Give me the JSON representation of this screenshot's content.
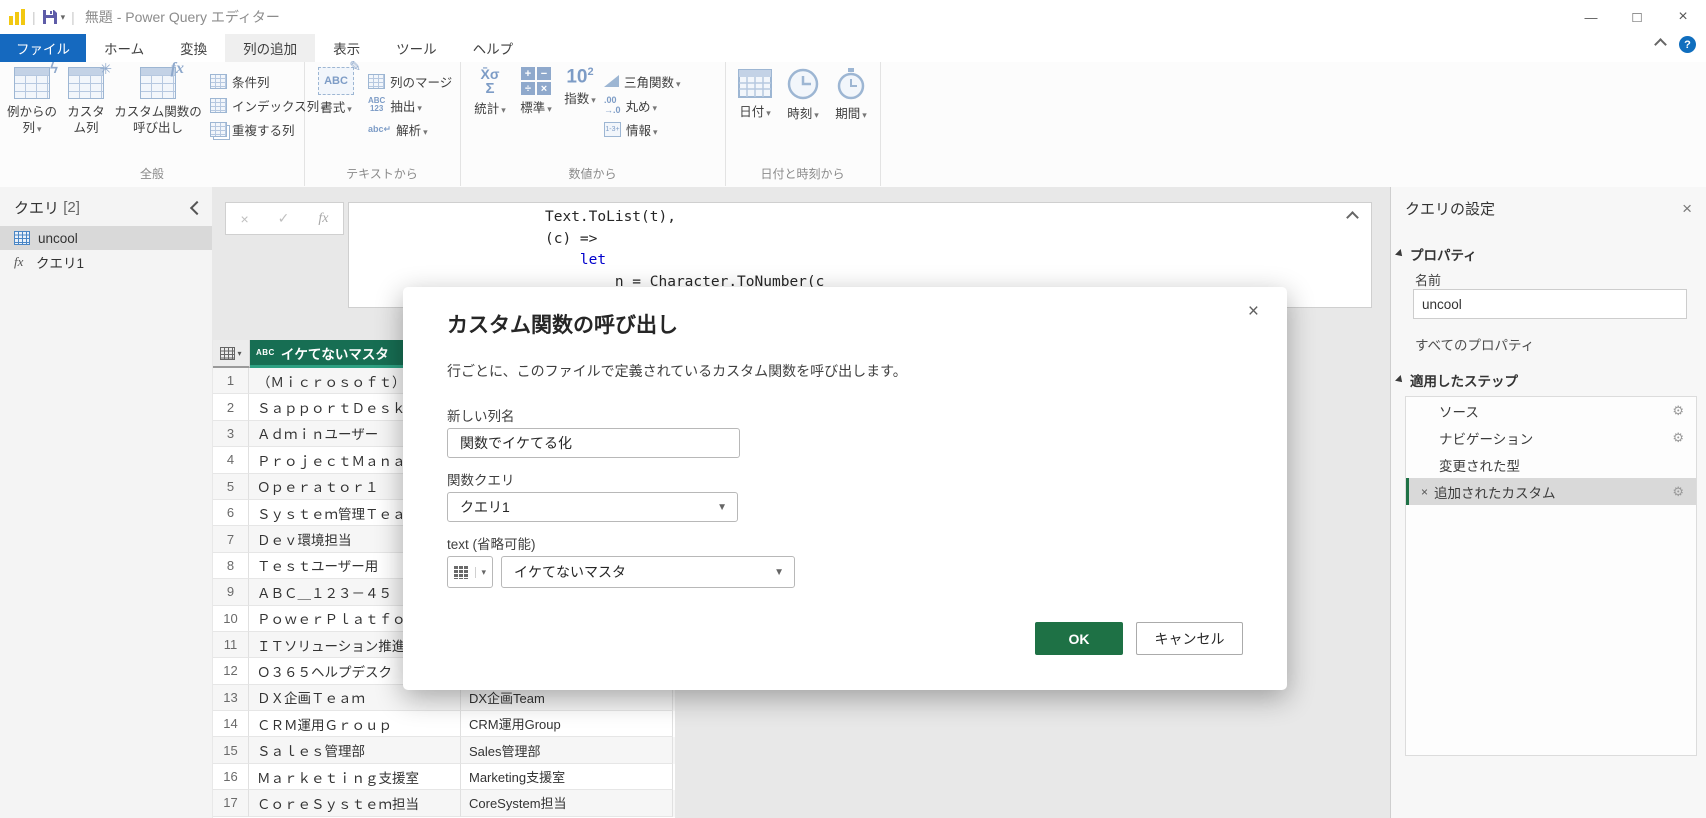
{
  "titlebar": {
    "title": "無題 - Power Query エディター"
  },
  "menu": {
    "tabs": [
      "ファイル",
      "ホーム",
      "変換",
      "列の追加",
      "表示",
      "ツール",
      "ヘルプ"
    ],
    "active_tab": "列の追加"
  },
  "ribbon": {
    "groups": [
      {
        "label": "全般",
        "big": [
          {
            "label": "例からの列"
          },
          {
            "label": "カスタム列"
          },
          {
            "label": "カスタム関数の呼び出し"
          }
        ],
        "small": [
          {
            "label": "条件列"
          },
          {
            "label": "インデックス列"
          },
          {
            "label": "重複する列"
          }
        ]
      },
      {
        "label": "テキストから",
        "big": [
          {
            "label": "書式"
          }
        ],
        "small": [
          {
            "label": "列のマージ"
          },
          {
            "label": "抽出"
          },
          {
            "label": "解析"
          }
        ]
      },
      {
        "label": "数値から",
        "big": [
          {
            "label": "統計"
          },
          {
            "label": "標準"
          },
          {
            "label": "指数"
          }
        ],
        "small": [
          {
            "label": "三角関数"
          },
          {
            "label": "丸め"
          },
          {
            "label": "情報"
          }
        ]
      },
      {
        "label": "日付と時刻から",
        "big": [
          {
            "label": "日付"
          },
          {
            "label": "時刻"
          },
          {
            "label": "期間"
          }
        ],
        "small": []
      }
    ]
  },
  "sidebar": {
    "title": "クエリ",
    "count": "[2]",
    "items": [
      {
        "label": "uncool",
        "selected": true
      },
      {
        "label": "クエリ1",
        "selected": false
      }
    ]
  },
  "formula": {
    "line1": "Text.ToList(t),",
    "line2": "(c) =>",
    "line3": "let",
    "line4": "n = Character.ToNumber(c"
  },
  "table": {
    "column1_header": "イケてないマスタ",
    "rows": [
      {
        "n": "1",
        "c1": "（Ｍｉｃｒｏｓｏｆｔ）サポート担",
        "c2": ""
      },
      {
        "n": "2",
        "c1": "ＳａｐｐｏｒｔＤｅｓｋ管理者",
        "c2": ""
      },
      {
        "n": "3",
        "c1": "Ａｄｍｉｎユーザー",
        "c2": ""
      },
      {
        "n": "4",
        "c1": "ＰｒｏｊｅｃｔＭａｎａｇｅｒ補佐",
        "c2": ""
      },
      {
        "n": "5",
        "c1": "Ｏｐｅｒａｔｏｒ１",
        "c2": ""
      },
      {
        "n": "6",
        "c1": "Ｓｙｓｔｅｍ管理Ｔｅａｍ",
        "c2": ""
      },
      {
        "n": "7",
        "c1": "Ｄｅｖ環境担当",
        "c2": ""
      },
      {
        "n": "8",
        "c1": "Ｔｅｓｔユーザー用",
        "c2": ""
      },
      {
        "n": "9",
        "c1": "ＡＢＣ＿１２３－４５",
        "c2": ""
      },
      {
        "n": "10",
        "c1": "ＰｏｗｅｒＰｌａｔｆｏｒｍ事業部",
        "c2": ""
      },
      {
        "n": "11",
        "c1": "ＩＴソリューション推進課",
        "c2": ""
      },
      {
        "n": "12",
        "c1": "Ｏ３６５ヘルプデスク",
        "c2": ""
      },
      {
        "n": "13",
        "c1": "ＤＸ企画Ｔｅａｍ",
        "c2": "DX企画Team"
      },
      {
        "n": "14",
        "c1": "ＣＲＭ運用Ｇｒｏｕｐ",
        "c2": "CRM運用Group"
      },
      {
        "n": "15",
        "c1": "Ｓａｌｅｓ管理部",
        "c2": "Sales管理部"
      },
      {
        "n": "16",
        "c1": "Ｍａｒｋｅｔｉｎｇ支援室",
        "c2": "Marketing支援室"
      },
      {
        "n": "17",
        "c1": "ＣｏｒｅＳｙｓｔｅｍ担当",
        "c2": "CoreSystem担当"
      }
    ]
  },
  "dialog": {
    "title": "カスタム関数の呼び出し",
    "description": "行ごとに、このファイルで定義されているカスタム関数を呼び出します。",
    "new_column_label": "新しい列名",
    "new_column_value": "関数でイケてる化",
    "function_query_label": "関数クエリ",
    "function_query_value": "クエリ1",
    "text_param_label": "text (省略可能)",
    "text_param_value": "イケてないマスタ",
    "ok_label": "OK",
    "cancel_label": "キャンセル"
  },
  "settings": {
    "title": "クエリの設定",
    "properties_label": "プロパティ",
    "name_label": "名前",
    "name_value": "uncool",
    "all_properties_label": "すべてのプロパティ",
    "applied_steps_label": "適用したステップ",
    "steps": [
      {
        "label": "ソース",
        "gear": true,
        "selected": false
      },
      {
        "label": "ナビゲーション",
        "gear": true,
        "selected": false
      },
      {
        "label": "変更された型",
        "gear": false,
        "selected": false
      },
      {
        "label": "追加されたカスタム",
        "gear": true,
        "selected": true
      }
    ]
  },
  "colors": {
    "file_tab_blue": "#1569BF",
    "table_header_green": "#176E53",
    "header_accent_teal": "#2EA082",
    "ok_button_green": "#1E7145",
    "selection_gray": "#D9D9D9",
    "power_bi_yellow": "#F2C811",
    "keyword_blue": "#0000CC"
  }
}
